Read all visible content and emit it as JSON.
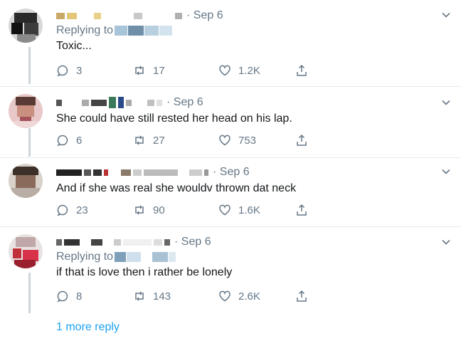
{
  "colors": {
    "accent": "#1da1f2",
    "secondary_text": "#657786",
    "primary_text": "#14171a",
    "divider": "#e6ecf0"
  },
  "tweets": [
    {
      "date": "· Sep 6",
      "replying_label": "Replying to",
      "text": "Toxic...",
      "replies": "3",
      "retweets": "17",
      "likes": "1.2K"
    },
    {
      "date": "· Sep 6",
      "replying_label": "",
      "text": "She could have still rested her head on his lap.",
      "replies": "6",
      "retweets": "27",
      "likes": "753"
    },
    {
      "date": "· Sep 6",
      "replying_label": "",
      "text": "And if she was real she wouldv thrown dat neck",
      "replies": "23",
      "retweets": "90",
      "likes": "1.6K"
    },
    {
      "date": "· Sep 6",
      "replying_label": "Replying to",
      "text": "if that is love then i rather be lonely",
      "replies": "8",
      "retweets": "143",
      "likes": "2.6K"
    }
  ],
  "more_replies": "1 more reply"
}
